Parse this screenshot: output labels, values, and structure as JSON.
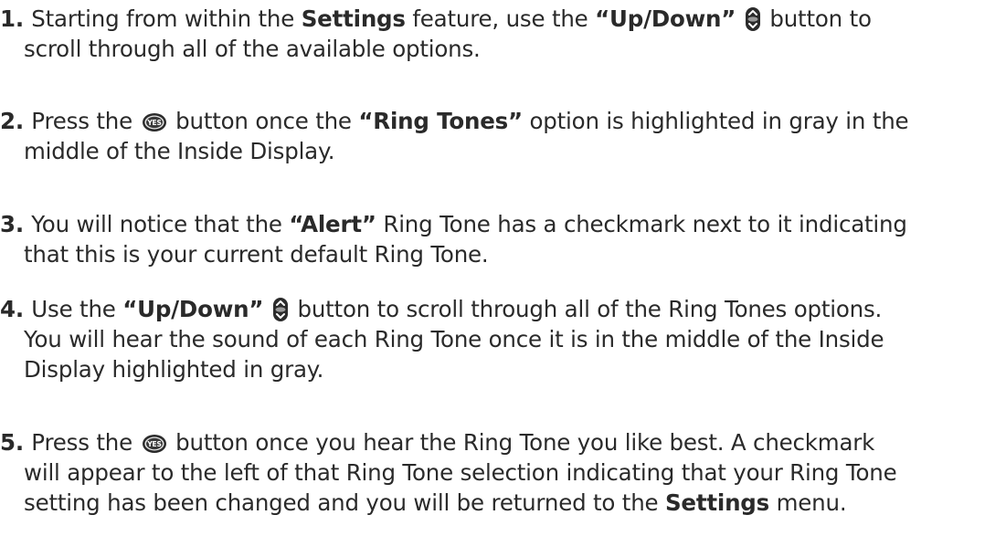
{
  "steps": [
    {
      "num": "1.",
      "parts": [
        {
          "t": "Starting from within the "
        },
        {
          "b": "Settings"
        },
        {
          "t": " feature, use the "
        },
        {
          "b": "“Up/Down”"
        },
        {
          "t": " "
        },
        {
          "icon": "up-down-button-icon"
        },
        {
          "t": " button to"
        },
        {
          "br": true
        },
        {
          "t": "scroll through all of the available options."
        }
      ]
    },
    {
      "num": "2.",
      "parts": [
        {
          "t": "Press the "
        },
        {
          "icon": "yes-button-icon"
        },
        {
          "t": " button once the "
        },
        {
          "b": "“Ring Tones”"
        },
        {
          "t": " option is highlighted in gray in the"
        },
        {
          "br": true
        },
        {
          "t": "middle of the Inside Display."
        }
      ]
    },
    {
      "num": "3.",
      "parts": [
        {
          "t": "You will notice that the "
        },
        {
          "b": "“Alert”"
        },
        {
          "t": " Ring Tone has a checkmark next to it indicating"
        },
        {
          "br": true
        },
        {
          "t": "that this is your current default Ring Tone."
        }
      ]
    },
    {
      "num": "4.",
      "parts": [
        {
          "t": "Use the "
        },
        {
          "b": "“Up/Down”"
        },
        {
          "t": " "
        },
        {
          "icon": "up-down-button-icon"
        },
        {
          "t": " button to scroll through all of the Ring Tones options."
        },
        {
          "br": true
        },
        {
          "t": "You will hear the sound of each Ring Tone once it is in the middle of the Inside"
        },
        {
          "br": true
        },
        {
          "t": "Display highlighted in gray."
        }
      ]
    },
    {
      "num": "5.",
      "parts": [
        {
          "t": "Press the "
        },
        {
          "icon": "yes-button-icon"
        },
        {
          "t": " button once you hear the Ring Tone you like best.  A checkmark"
        },
        {
          "br": true
        },
        {
          "t": "will appear to the left of that Ring Tone selection indicating that your Ring Tone"
        },
        {
          "br": true
        },
        {
          "t": "setting has been changed and you will be returned to the "
        },
        {
          "b": "Settings"
        },
        {
          "t": " menu."
        }
      ]
    }
  ],
  "icons": {
    "up_down_color": "#2b2b2b",
    "yes_label": "YES"
  }
}
